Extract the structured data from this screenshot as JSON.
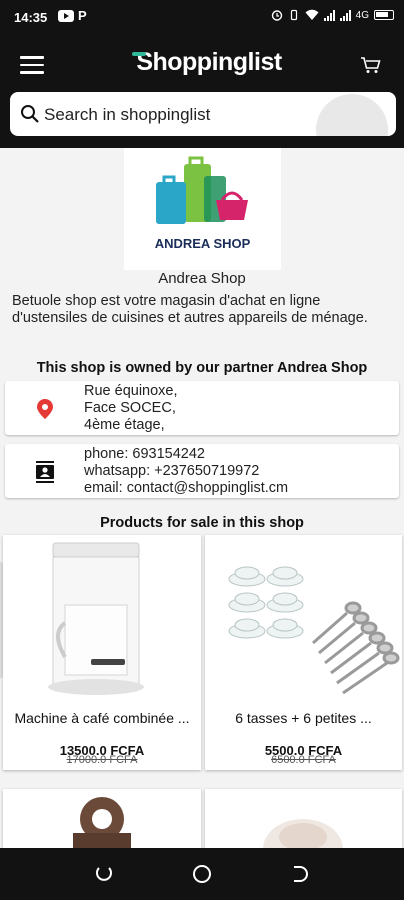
{
  "status_bar": {
    "time": "14:35",
    "p_label": "P",
    "lte": "4G",
    "battery_label": ""
  },
  "header": {
    "app_title": "Shoppinglist"
  },
  "search": {
    "placeholder": "Search in shoppinglist"
  },
  "shop": {
    "logo_text": "ANDREA SHOP",
    "name": "Andrea Shop",
    "description": "Betuole shop est votre magasin d'achat en ligne d'ustensiles de cuisines et autres appareils de ménage.",
    "partner_line": "This shop is owned by our partner Andrea Shop",
    "address": [
      "Rue équinoxe,",
      "Face SOCEC,",
      "4ème étage,"
    ],
    "contact": [
      "phone: 693154242",
      "whatsapp: +237650719972",
      "email: contact@shoppinglist.cm"
    ]
  },
  "products_section": {
    "title": "Products for sale in this shop",
    "items": [
      {
        "title": "Machine à café combinée ...",
        "price": "13500.0 FCFA",
        "old_price": "17000.0 FCFA"
      },
      {
        "title": "6 tasses + 6 petites ...",
        "price": "5500.0 FCFA",
        "old_price": "6500.0 FCFA"
      }
    ]
  },
  "colors": {
    "dark": "#121212",
    "accent": "#2fb89a",
    "pin": "#e53935"
  }
}
